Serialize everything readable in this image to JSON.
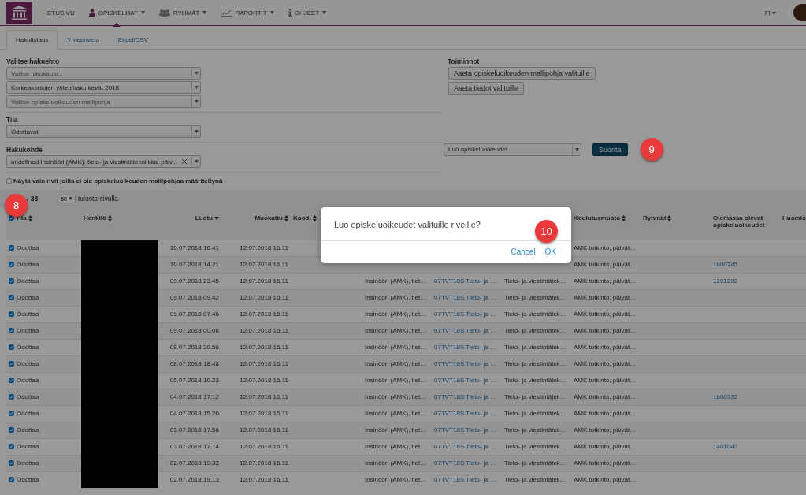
{
  "nav": {
    "items": [
      {
        "label": "ETUSIVU",
        "kind": "plain",
        "dropdown": false,
        "selected": false
      },
      {
        "label": "OPISKELIJAT",
        "kind": "person",
        "dropdown": true,
        "selected": true
      },
      {
        "label": "RYHMÄT",
        "kind": "group",
        "dropdown": true,
        "selected": false
      },
      {
        "label": "RAPORTIT",
        "kind": "chart",
        "dropdown": true,
        "selected": false
      },
      {
        "label": "OHJEET",
        "kind": "info",
        "dropdown": true,
        "selected": false
      }
    ],
    "language": "FI"
  },
  "tabs": [
    {
      "label": "Hakulistaus",
      "selected": true
    },
    {
      "label": "Yhteenveto",
      "selected": false
    },
    {
      "label": "Excel/CSV",
      "selected": false
    }
  ],
  "filters": {
    "title": "Valitse hakuehto",
    "selects": [
      {
        "placeholder": "Valitse lukukausi..."
      },
      {
        "value": "Korkeakoulujen yhteishaku kevät 2018"
      },
      {
        "placeholder": "Valitse opiskeluoikeuden mallipohja"
      }
    ],
    "state_label": "Tila",
    "state": {
      "value": "Odottavat"
    },
    "target_label": "Hakukohde",
    "target": {
      "value": "undefined Insinööri (AMK), tieto- ja viestintätekniikka, päiv...",
      "clearable": true
    },
    "only_missing": {
      "label": "Näytä vain rivit joilla ei ole opiskeluoikeuden mallipohjaa määriteltynä",
      "checked": false
    }
  },
  "actions": {
    "title": "Toiminnot",
    "buttons": [
      "Aseta opiskeluoikeuden mallipohja valituille",
      "Aseta tiedot valituille"
    ],
    "bulk": {
      "value": "Luo opiskeluoikeudet",
      "button": "Suorita",
      "badge": "9"
    }
  },
  "pager": {
    "count": "/ 38",
    "page_size": "50",
    "label": "tulosta sivulla",
    "badge": "8"
  },
  "table": {
    "all_checked": true,
    "redacted": true,
    "columns": [
      {
        "label": "Tila",
        "kind": "sortable"
      },
      {
        "label": "Henkilö",
        "kind": "sortable"
      },
      {
        "label": "Luotu",
        "kind": "sorted"
      },
      {
        "label": "Muokattu",
        "kind": "sortable"
      },
      {
        "label": "Koodi",
        "kind": "sortable"
      },
      {},
      {},
      {},
      {
        "label": "Koulutusmuoto",
        "kind": "sortable"
      },
      {
        "label": "Ryhmät",
        "kind": "sortable"
      },
      {
        "label": "Olemassa olevat opiskeluoikeudet",
        "kind": "plain"
      },
      {
        "label": "Huomio",
        "kind": "plain"
      }
    ],
    "rows": [
      {
        "checked": true,
        "state": "Odottaa",
        "created": "10.07.2018 16.41",
        "modified": "12.07.2018 16.11",
        "form": "AMK tutkinto, päivät…"
      },
      {
        "checked": true,
        "state": "Odottaa",
        "created": "10.07.2018 14.21",
        "modified": "12.07.2018 16.11",
        "form": "AMK tutkinto, päivät…",
        "existing": "1800745"
      },
      {
        "checked": true,
        "state": "Odottaa",
        "created": "09.07.2018 23.45",
        "modified": "12.07.2018 16.11",
        "column_6": "Insinööri (AMK), tiet…",
        "column_7": "07TVT18S Tieto- ja …",
        "column_8": "Tieto- ja viestintätek…",
        "form": "AMK tutkinto, päivät…",
        "existing": "1201292"
      },
      {
        "checked": true,
        "state": "Odottaa",
        "created": "09.07.2018 09.42",
        "modified": "12.07.2018 16.11",
        "column_6": "Insinööri (AMK), tiet…",
        "column_7": "07TVT18S Tieto- ja …",
        "column_8": "Tieto- ja viestintätek…",
        "form": "AMK tutkinto, päivät…"
      },
      {
        "checked": true,
        "state": "Odottaa",
        "created": "09.07.2018 07.46",
        "modified": "12.07.2018 16.11",
        "column_6": "Insinööri (AMK), tiet…",
        "column_7": "07TVT18S Tieto- ja …",
        "column_8": "Tieto- ja viestintätek…",
        "form": "AMK tutkinto, päivät…"
      },
      {
        "checked": true,
        "state": "Odottaa",
        "created": "09.07.2018 00.06",
        "modified": "12.07.2018 16.11",
        "column_6": "Insinööri (AMK), tiet…",
        "column_7": "07TVT18S Tieto- ja …",
        "column_8": "Tieto- ja viestintätek…",
        "form": "AMK tutkinto, päivät…"
      },
      {
        "checked": true,
        "state": "Odottaa",
        "created": "08.07.2018 20.56",
        "modified": "12.07.2018 16.11",
        "column_6": "Insinööri (AMK), tiet…",
        "column_7": "07TVT18S Tieto- ja …",
        "column_8": "Tieto- ja viestintätek…",
        "form": "AMK tutkinto, päivät…"
      },
      {
        "checked": true,
        "state": "Odottaa",
        "created": "08.07.2018 18.48",
        "modified": "12.07.2018 16.11",
        "column_6": "Insinööri (AMK), tiet…",
        "column_7": "07TVT18S Tieto- ja …",
        "column_8": "Tieto- ja viestintätek…",
        "form": "AMK tutkinto, päivät…"
      },
      {
        "checked": true,
        "state": "Odottaa",
        "created": "05.07.2018 10.23",
        "modified": "12.07.2018 16.11",
        "column_6": "Insinööri (AMK), tiet…",
        "column_7": "07TVT18S Tieto- ja …",
        "column_8": "Tieto- ja viestintätek…",
        "form": "AMK tutkinto, päivät…"
      },
      {
        "checked": true,
        "state": "Odottaa",
        "created": "04.07.2018 17.12",
        "modified": "12.07.2018 16.11",
        "column_6": "Insinööri (AMK), tiet…",
        "column_7": "07TVT18S Tieto- ja …",
        "column_8": "Tieto- ja viestintätek…",
        "form": "AMK tutkinto, päivät…",
        "existing": "1800532"
      },
      {
        "checked": true,
        "state": "Odottaa",
        "created": "04.07.2018 15.20",
        "modified": "12.07.2018 16.11",
        "column_6": "Insinööri (AMK), tiet…",
        "column_7": "07TVT18S Tieto- ja …",
        "column_8": "Tieto- ja viestintätek…",
        "form": "AMK tutkinto, päivät…"
      },
      {
        "checked": true,
        "state": "Odottaa",
        "created": "03.07.2018 17.56",
        "modified": "12.07.2018 16.11",
        "column_6": "Insinööri (AMK), tiet…",
        "column_7": "07TVT18S Tieto- ja …",
        "column_8": "Tieto- ja viestintätek…",
        "form": "AMK tutkinto, päivät…"
      },
      {
        "checked": true,
        "state": "Odottaa",
        "created": "03.07.2018 17.14",
        "modified": "12.07.2018 16.11",
        "column_6": "Insinööri (AMK), tiet…",
        "column_7": "07TVT18S Tieto- ja …",
        "column_8": "Tieto- ja viestintätek…",
        "form": "AMK tutkinto, päivät…",
        "existing": "1401043"
      },
      {
        "checked": true,
        "state": "Odottaa",
        "created": "02.07.2018 19.33",
        "modified": "12.07.2018 16.11",
        "column_6": "Insinööri (AMK), tiet…",
        "column_7": "07TVT18S Tieto- ja …",
        "column_8": "Tieto- ja viestintätek…",
        "form": "AMK tutkinto, päivät…"
      },
      {
        "checked": true,
        "state": "Odottaa",
        "created": "02.07.2018 19.13",
        "modified": "12.07.2018 16.11",
        "column_6": "Insinööri (AMK), tiet…",
        "column_7": "07TVT18S Tieto- ja …",
        "column_8": "Tieto- ja viestintätek…",
        "form": "AMK tutkinto, päivät…"
      }
    ]
  },
  "dialog": {
    "message": "Luo opiskeluoikeudet valituille riveille?",
    "buttons": [
      "Cancel",
      "OK"
    ],
    "badge": "10"
  }
}
